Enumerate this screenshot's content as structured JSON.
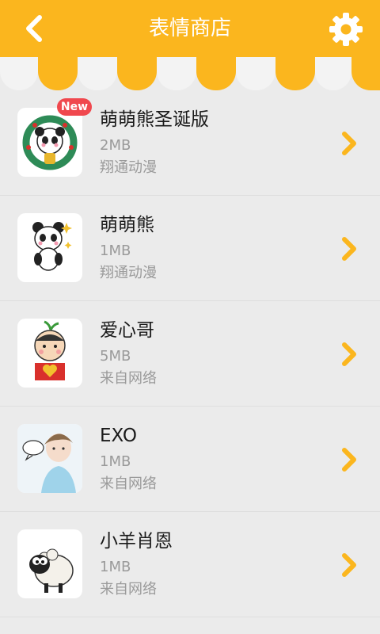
{
  "header": {
    "title": "表情商店",
    "back_icon": "back-arrow-icon",
    "settings_icon": "gear-icon",
    "bg_color": "#fbb61e"
  },
  "items": [
    {
      "name": "萌萌熊圣诞版",
      "size": "2MB",
      "source": "翔通动漫",
      "badge": "New",
      "thumb": "panda-christmas-sticker"
    },
    {
      "name": "萌萌熊",
      "size": "1MB",
      "source": "翔通动漫",
      "badge": "",
      "thumb": "panda-sticker"
    },
    {
      "name": "爱心哥",
      "size": "5MB",
      "source": "来自网络",
      "badge": "",
      "thumb": "heart-boy-sticker"
    },
    {
      "name": "EXO",
      "size": "1MB",
      "source": "来自网络",
      "badge": "",
      "thumb": "exo-member-sticker"
    },
    {
      "name": "小羊肖恩",
      "size": "1MB",
      "source": "来自网络",
      "badge": "",
      "thumb": "shaun-sheep-sticker"
    }
  ],
  "colors": {
    "accent": "#fbb61e",
    "badge": "#f0484e",
    "chevron": "#fbb61e"
  }
}
